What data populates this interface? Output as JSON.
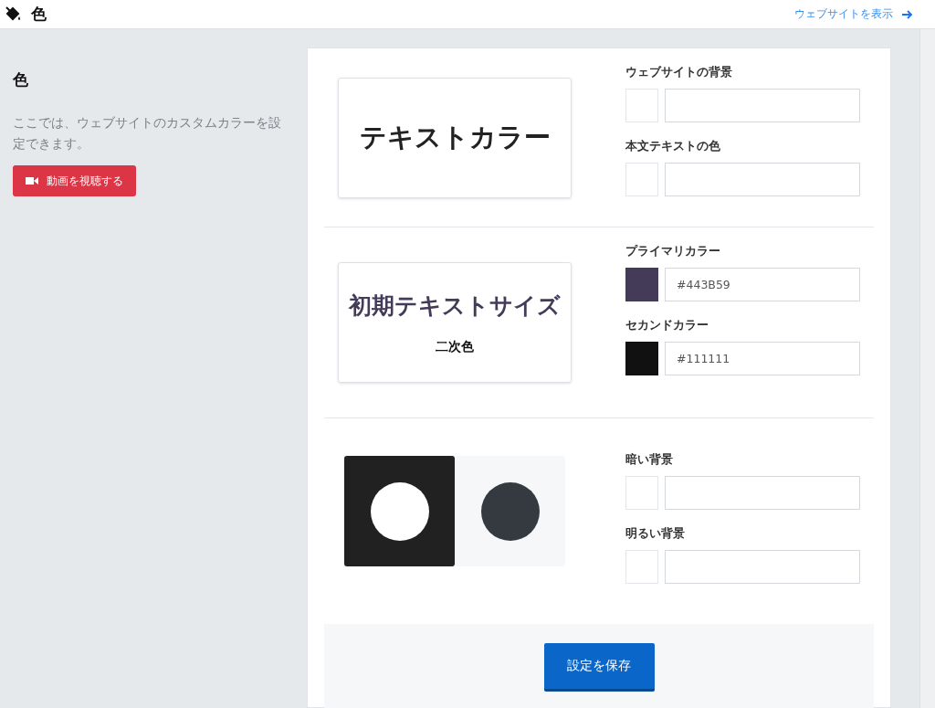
{
  "header": {
    "title": "色",
    "link": "ウェブサイトを表示"
  },
  "intro": {
    "heading": "色",
    "description": "ここでは、ウェブサイトのカスタムカラーを設定できます。",
    "video_button": "動画を視聴する"
  },
  "sections": [
    {
      "preview": {
        "kind": "text",
        "title": "テキストカラー"
      },
      "fields": [
        {
          "label": "ウェブサイトの背景"
        },
        {
          "label": "本文テキストの色"
        }
      ]
    },
    {
      "preview": {
        "kind": "text-pair",
        "title": "初期テキストサイズ",
        "subtitle": "二次色"
      },
      "fields": [
        {
          "label": "プライマリカラー",
          "value": "#443B59",
          "color": "#443b59"
        },
        {
          "label": "セカンドカラー",
          "value": "#111111",
          "color": "#111111"
        }
      ]
    },
    {
      "preview": {
        "kind": "circles"
      },
      "fields": [
        {
          "label": "暗い背景"
        },
        {
          "label": "明るい背景"
        }
      ]
    }
  ],
  "save_button": "設定を保存"
}
